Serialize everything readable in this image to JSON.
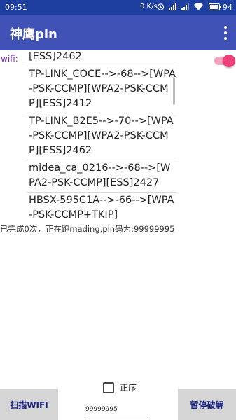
{
  "status_bar": {
    "time": "09:51",
    "net_speed": "0 K/s",
    "battery": "94",
    "battery_level": 0.94,
    "icons": [
      "alarm-icon",
      "signal-icon",
      "signal-icon",
      "wifi-icon"
    ]
  },
  "app_bar": {
    "title": "神鹰pin",
    "menu_icon": "more-vertical-icon"
  },
  "wifi": {
    "label": "wifi:",
    "toggle_on": true
  },
  "networks": [
    "[ESS]2462",
    "TP-LINK_COCE-->-68-->[WPA-PSK-CCMP][WPA2-PSK-CCMP][ESS]2412",
    "TP-LINK_B2E5-->-70-->[WPA-PSK-CCMP][WPA2-PSK-CCMP][ESS]2462",
    "midea_ca_0216-->-68-->[WPA2-PSK-CCMP][ESS]2427",
    "HBSX-595C1A-->-66-->[WPA-PSK-CCMP+TKIP]"
  ],
  "progress_text": "已完成0次，正在跑mading,pin码为:99999995",
  "controls": {
    "scan_label": "扫描WIFI",
    "order_label": "正序",
    "order_checked": false,
    "pin_value": "99999995",
    "pause_label": "暂停破解"
  },
  "colors": {
    "status_bar": "#1e3ea0",
    "app_bar": "#3f51b5",
    "wifi_label": "#7b2cbf",
    "toggle_thumb": "#ec407a",
    "button_text": "#1a237e",
    "button_bg": "#d6d6d6"
  }
}
